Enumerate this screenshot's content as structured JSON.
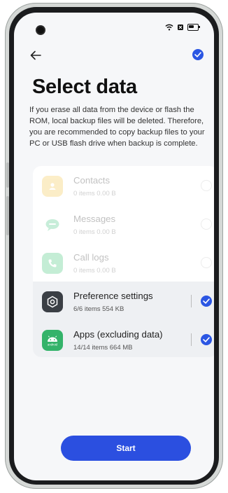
{
  "header": {
    "title": "Select data",
    "description": "If you erase all data from the device or flash the ROM, local backup files will be deleted. Therefore, you are recommended to copy backup files to your PC or USB flash drive when backup is complete."
  },
  "items": [
    {
      "name": "Contacts",
      "meta": "0 items   0.00 B",
      "icon": "contacts-icon",
      "selected": false,
      "enabled": false
    },
    {
      "name": "Messages",
      "meta": "0 items   0.00 B",
      "icon": "messages-icon",
      "selected": false,
      "enabled": false
    },
    {
      "name": "Call logs",
      "meta": "0 items   0.00 B",
      "icon": "call-logs-icon",
      "selected": false,
      "enabled": false
    },
    {
      "name": "Preference settings",
      "meta": "6/6 items   554 KB",
      "icon": "settings-gear-icon",
      "selected": true,
      "enabled": true
    },
    {
      "name": "Apps (excluding data)",
      "meta": "14/14 items   664 MB",
      "icon": "android-apps-icon",
      "selected": true,
      "enabled": true
    }
  ],
  "footer": {
    "start_label": "Start",
    "android_badge": "android"
  },
  "colors": {
    "accent": "#2b56e3",
    "contacts": "#f4c03a",
    "messages": "#39c27a",
    "calls": "#2fbf6a",
    "settings": "#3b3f45",
    "apps": "#34b36a"
  }
}
